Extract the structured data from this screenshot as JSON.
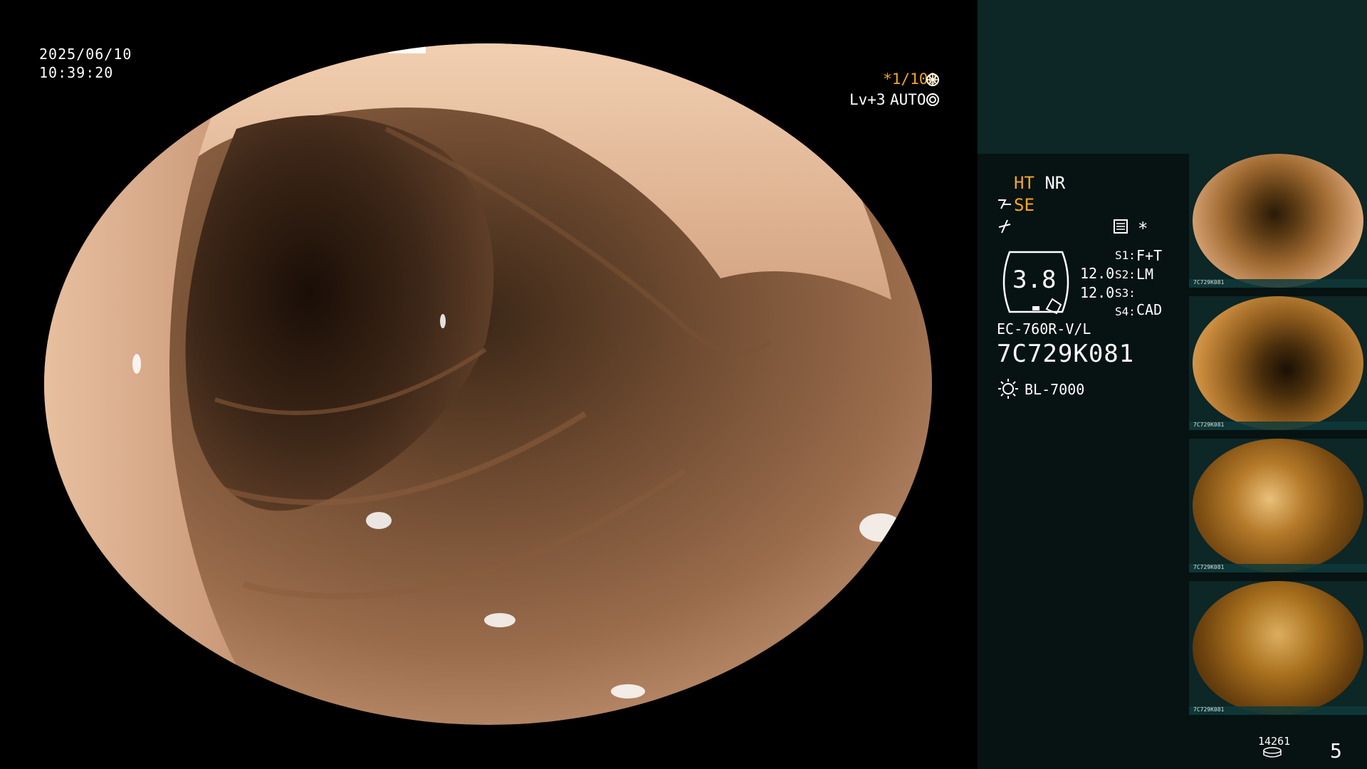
{
  "timestamp": {
    "date": "2025/06/10",
    "time": "10:39:20"
  },
  "overlay": {
    "shutter": "*1/100",
    "shutter_icon": "aperture-icon",
    "level": "Lv+3",
    "auto": "AUTO",
    "auto_icon": "iris-icon"
  },
  "panel": {
    "ht": "HT",
    "nr": "NR",
    "se": "SE",
    "se_icon": "scope-tip-icon",
    "signal_icon": "signal-icon",
    "menu_icon": "settings-menu-icon",
    "star": "*",
    "gauge_value": "3.8",
    "ref1": "12.0",
    "ref2": "12.0",
    "s1_label": "S1:",
    "s1_value": "F+T",
    "s2_label": "S2:",
    "s2_value": "LM",
    "s3_label": "S3:",
    "s3_value": "",
    "s4_label": "S4:",
    "s4_value": "CAD",
    "scope_model": "EC-760R-V/L",
    "serial": "7C729K081",
    "light_icon": "light-source-icon",
    "light_source": "BL-7000"
  },
  "thumbnails": [
    {
      "caption": "7C729K081"
    },
    {
      "caption": "7C729K081"
    },
    {
      "caption": "7C729K081"
    },
    {
      "caption": "7C729K081"
    }
  ],
  "footer": {
    "storage_count": "14261",
    "storage_icon": "disk-stack-icon",
    "image_count": "5"
  },
  "colors": {
    "accent_amber": "#f5a623",
    "panel_bg": "#071212",
    "panel_header_bg": "#0d2626"
  }
}
